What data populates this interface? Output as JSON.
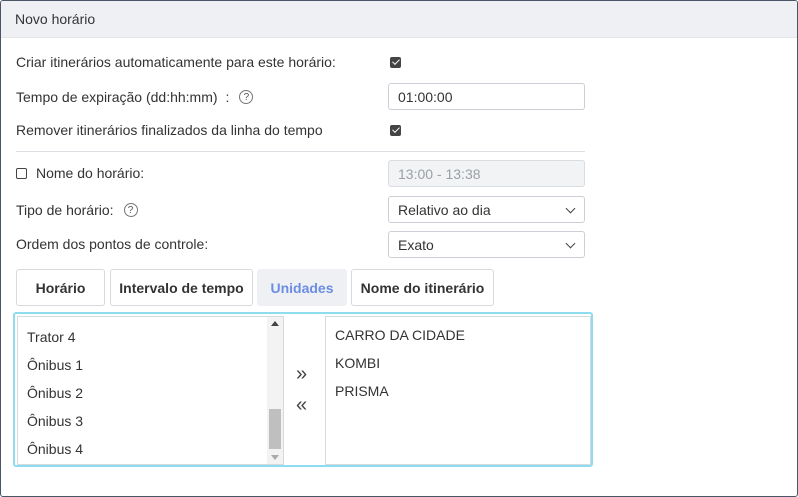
{
  "title": "Novo horário",
  "auto_create": {
    "label": "Criar itinerários automaticamente para este horário:",
    "checked": true
  },
  "expiration": {
    "label": "Tempo de expiração (dd:hh:mm)",
    "colon": ":",
    "help": "?",
    "value": "01:00:00"
  },
  "remove_finished": {
    "label": "Remover itinerários finalizados da linha do tempo",
    "checked": true
  },
  "schedule_name": {
    "label": "Nome do horário:",
    "checked": false,
    "value": "13:00 - 13:38"
  },
  "schedule_type": {
    "label": "Tipo de horário:",
    "help": "?",
    "value": "Relativo ao dia"
  },
  "checkpoint_order": {
    "label": "Ordem dos pontos de controle:",
    "value": "Exato"
  },
  "tabs": [
    {
      "label": "Horário",
      "active": false
    },
    {
      "label": "Intervalo de tempo",
      "active": false
    },
    {
      "label": "Unidades",
      "active": true
    },
    {
      "label": "Nome do itinerário",
      "active": false
    }
  ],
  "available_units": [
    "Trator 4",
    "Ônibus 1",
    "Ônibus 2",
    "Ônibus 3",
    "Ônibus 4"
  ],
  "selected_units": [
    "CARRO DA CIDADE",
    "KOMBI",
    "PRISMA"
  ],
  "move_right": "»",
  "move_left": "«",
  "colors": {
    "accent": "#6b8de3",
    "panel_border": "#8edcf0"
  }
}
